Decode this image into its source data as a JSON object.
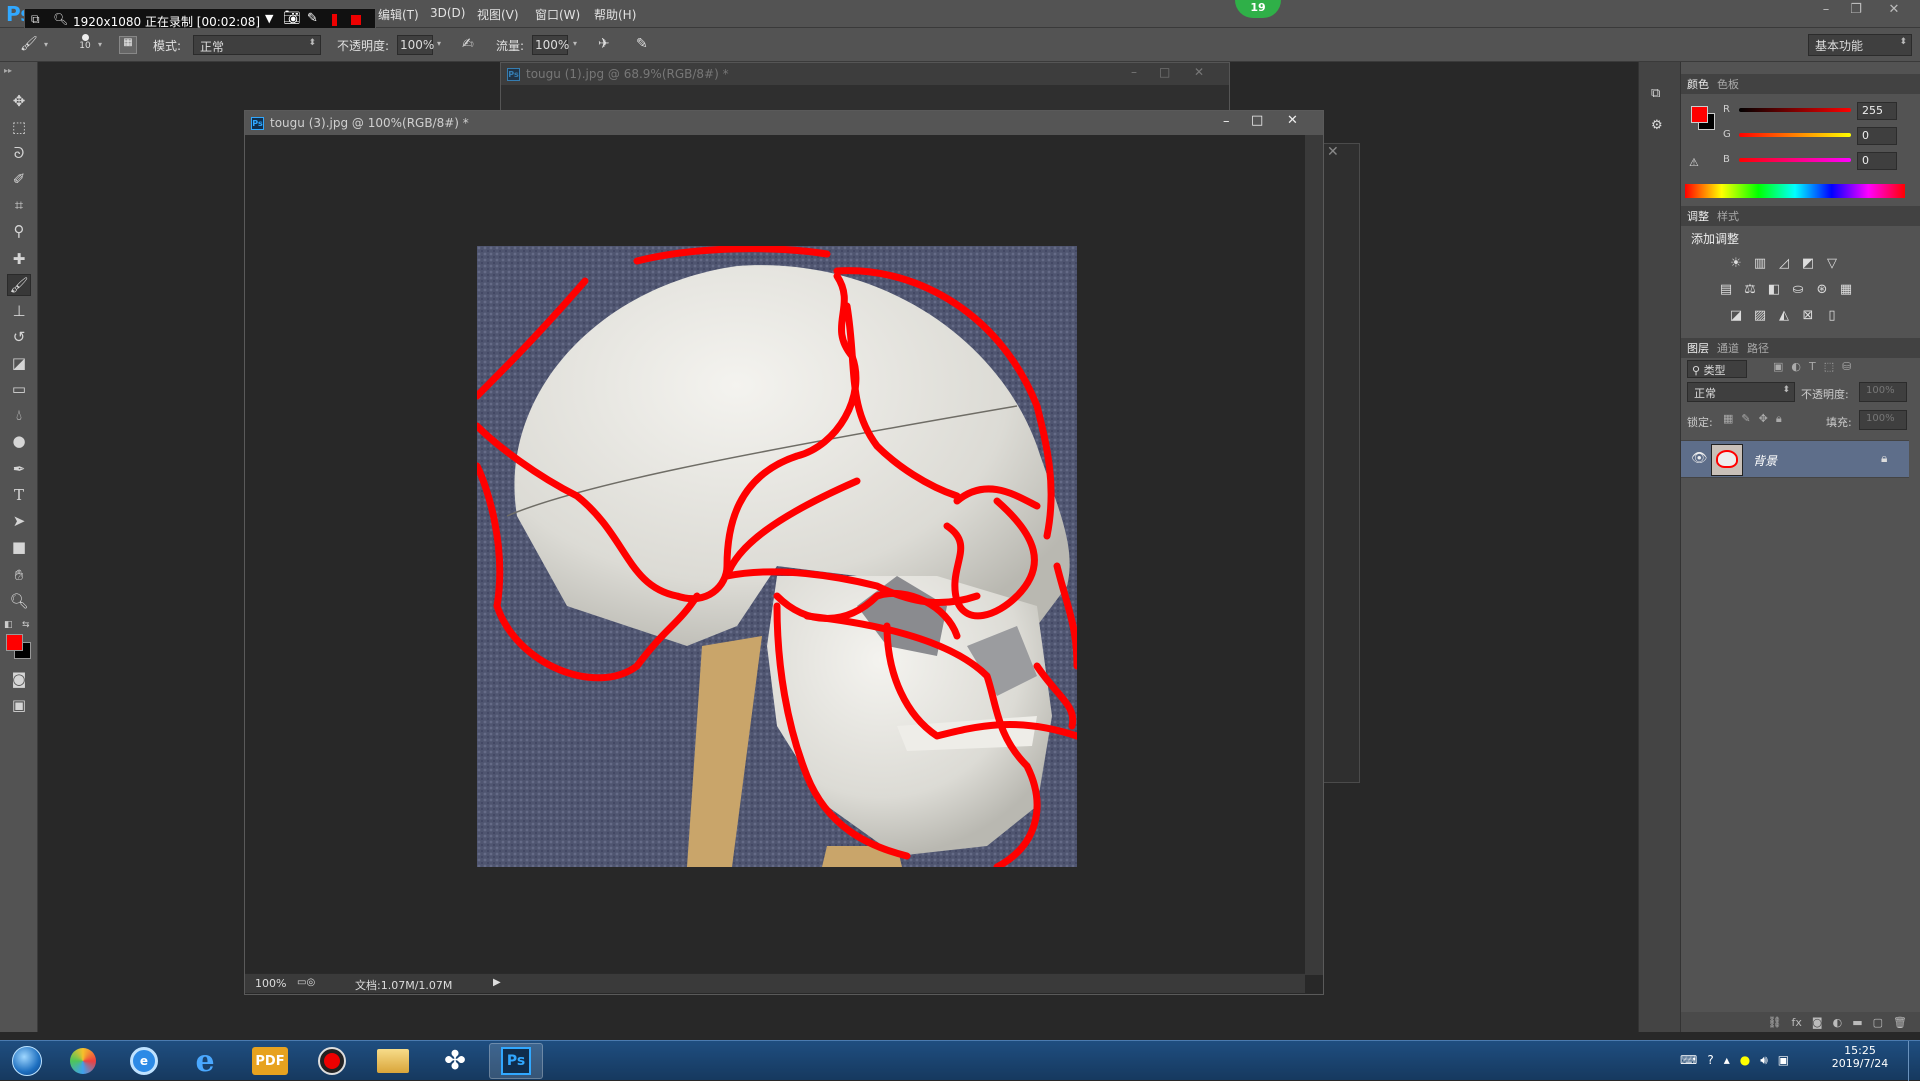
{
  "app": {
    "logo": "Ps",
    "menus": [
      "编辑(T)",
      "3D(D)",
      "视图(V)",
      "窗口(W)",
      "帮助(H)"
    ],
    "workspace": "基本功能",
    "badge_count": "19"
  },
  "recorder": {
    "text": "1920x1080 正在录制 [00:02:08]"
  },
  "options": {
    "brush_size": "10",
    "mode_label": "模式:",
    "mode_value": "正常",
    "opacity_label": "不透明度:",
    "opacity_value": "100%",
    "flow_label": "流量:",
    "flow_value": "100%"
  },
  "documents": {
    "back_title": "tougu (1).jpg @ 68.9%(RGB/8#) *",
    "front_title": "tougu (3).jpg @ 100%(RGB/8#) *",
    "zoom": "100%",
    "doc_size": "文档:1.07M/1.07M"
  },
  "color_panel": {
    "tabs": [
      "颜色",
      "色板"
    ],
    "r_label": "R",
    "r_value": "255",
    "g_label": "G",
    "g_value": "0",
    "b_label": "B",
    "b_value": "0",
    "foreground": "#ff0000",
    "background": "#000000"
  },
  "adjustments_panel": {
    "tabs": [
      "调整",
      "样式"
    ],
    "heading": "添加调整"
  },
  "layers_panel": {
    "tabs": [
      "图层",
      "通道",
      "路径"
    ],
    "filter_label": "类型",
    "blend_mode": "正常",
    "opacity_label": "不透明度:",
    "opacity_value": "100%",
    "lock_label": "锁定:",
    "fill_label": "填充:",
    "fill_value": "100%",
    "layers": [
      {
        "name": "背景",
        "locked": true,
        "visible": true
      }
    ]
  },
  "taskbar": {
    "time": "15:25",
    "date": "2019/7/24",
    "pdf_label": "PDF",
    "ps_label": "Ps"
  }
}
